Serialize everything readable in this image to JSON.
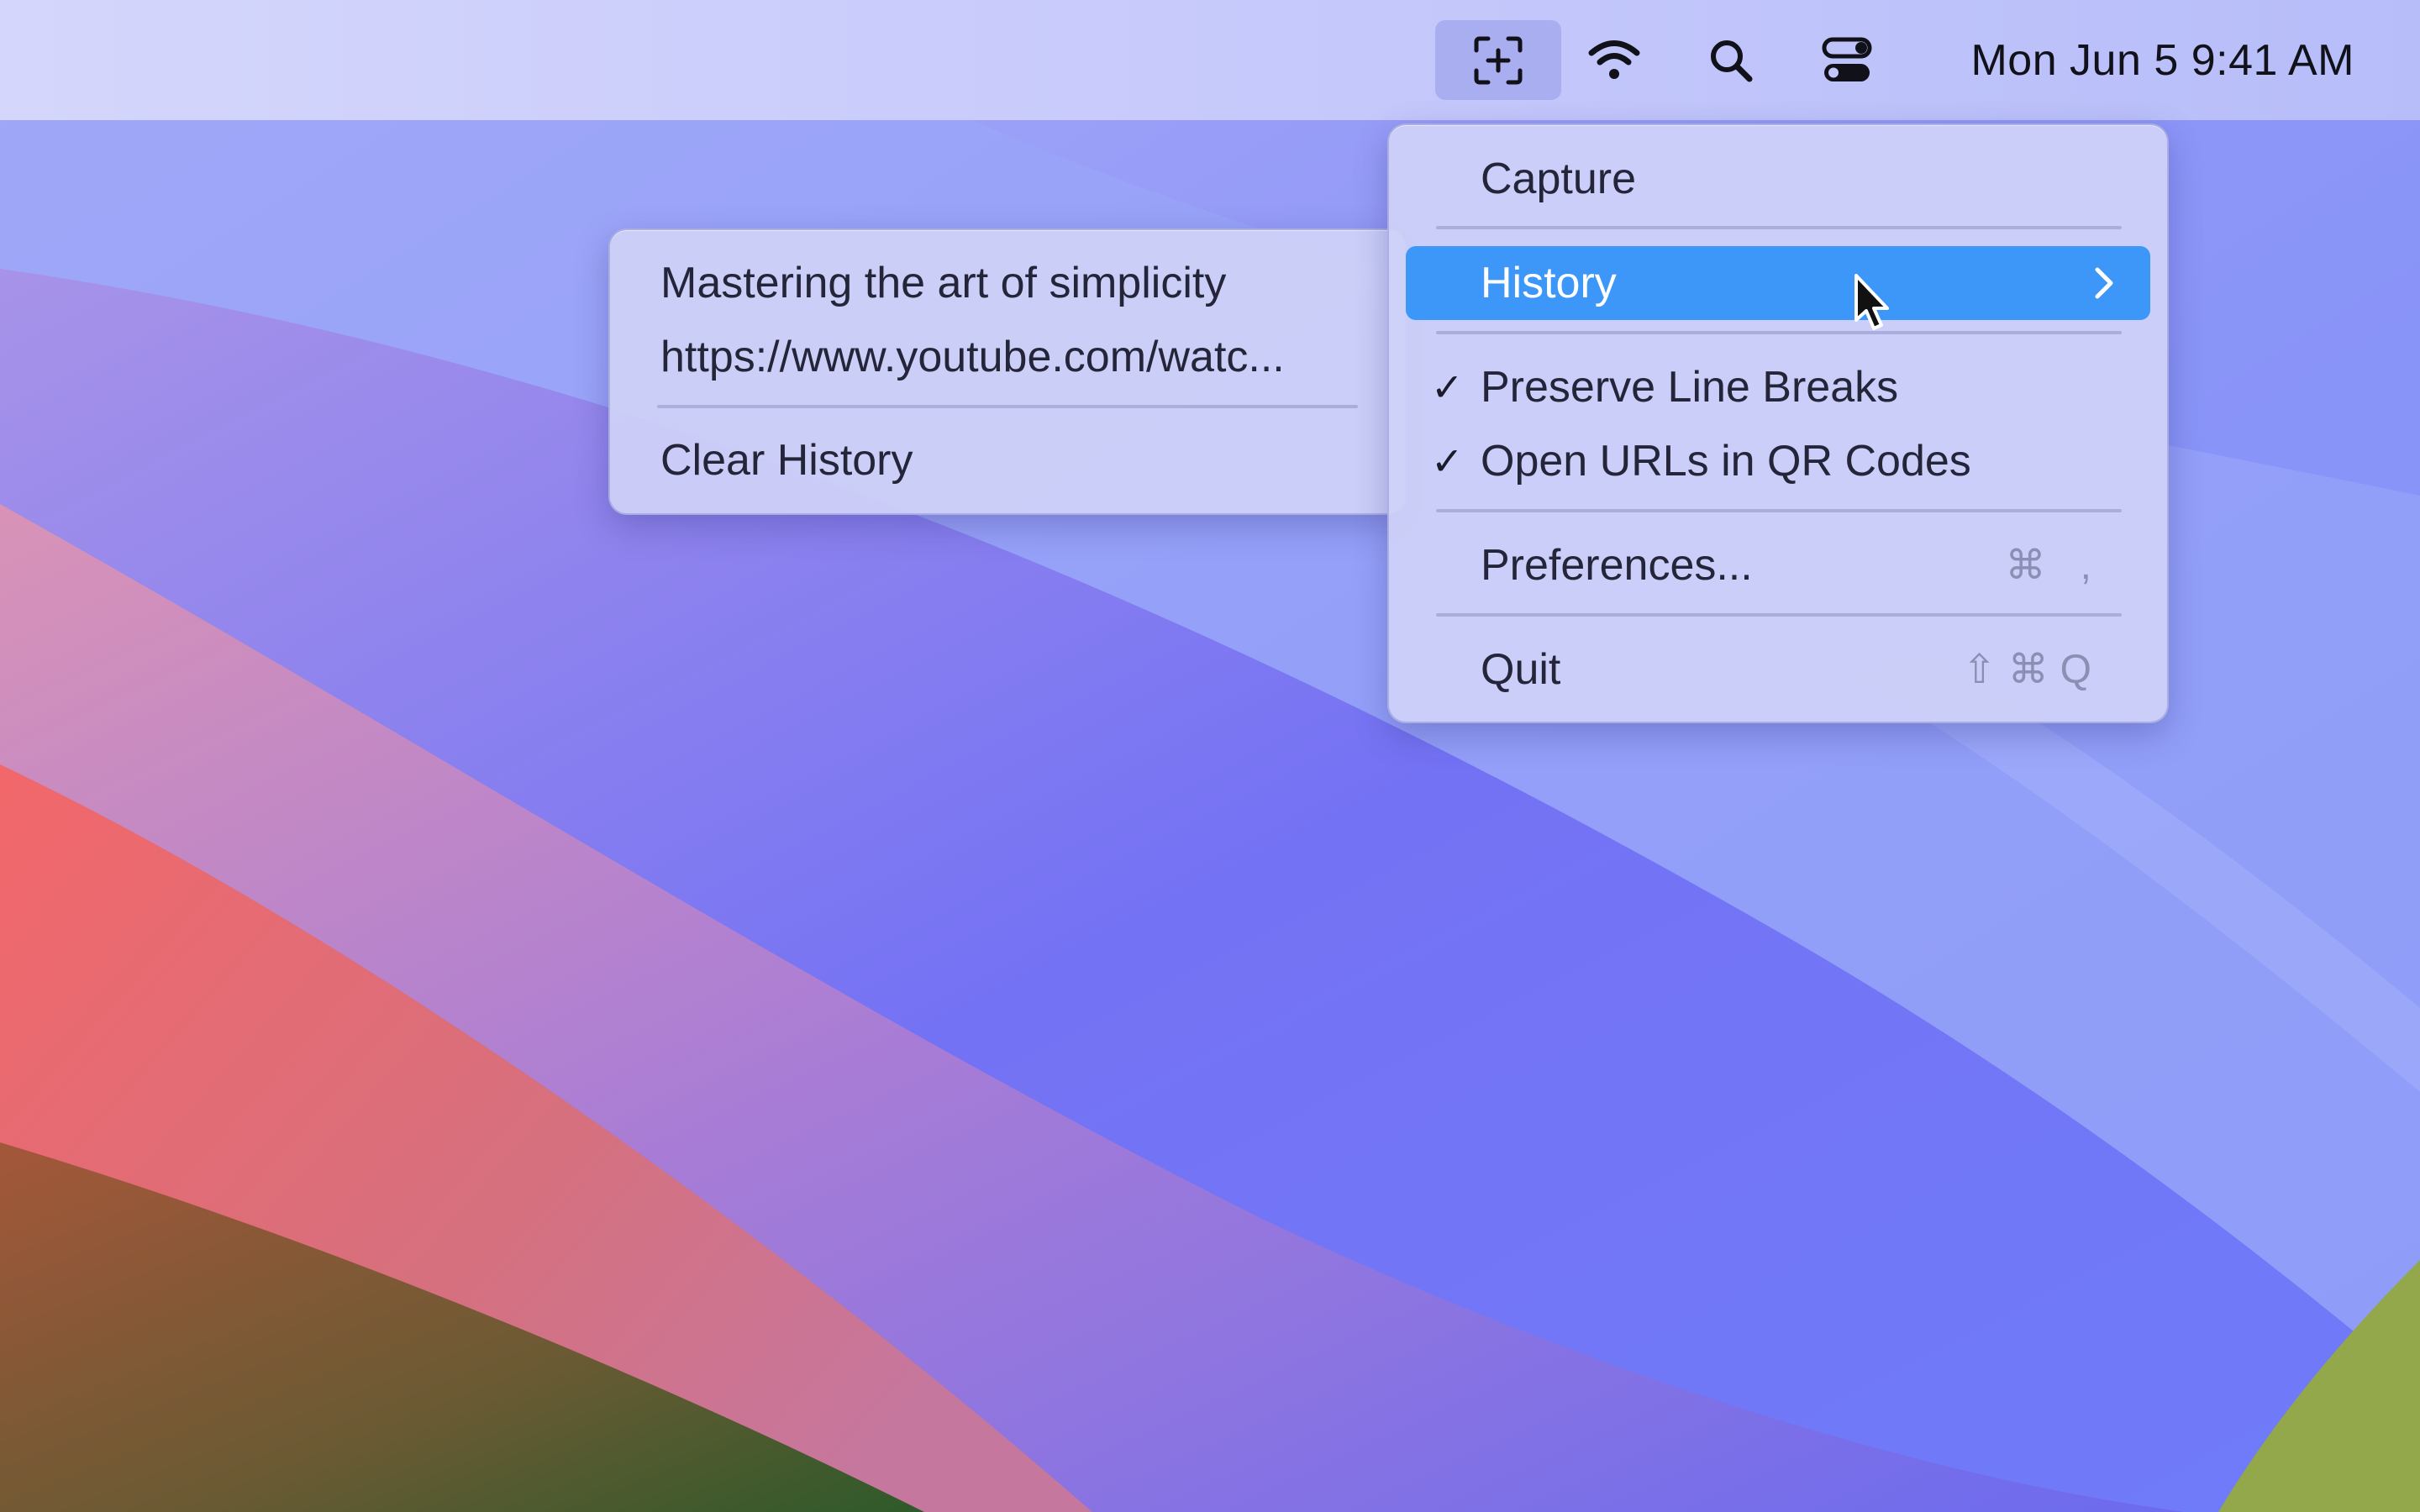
{
  "menubar": {
    "status_icons": [
      "text-capture-icon",
      "wifi-icon",
      "search-icon",
      "control-center-icon"
    ],
    "clock": "Mon Jun 5  9:41 AM"
  },
  "main_menu": {
    "capture": "Capture",
    "history": "History",
    "preserve_line_breaks": "Preserve Line Breaks",
    "preserve_line_breaks_checked": true,
    "open_urls_qr": "Open URLs in QR Codes",
    "open_urls_qr_checked": true,
    "preferences": "Preferences...",
    "preferences_shortcut": "⌘ ,",
    "quit": "Quit",
    "quit_shortcut": "⇧⌘Q",
    "check_mark": "✓",
    "highlight_color": "#3c97f8"
  },
  "history_submenu": {
    "items": [
      "Mastering the art of simplicity",
      "https://www.youtube.com/watc..."
    ],
    "clear": "Clear History"
  }
}
